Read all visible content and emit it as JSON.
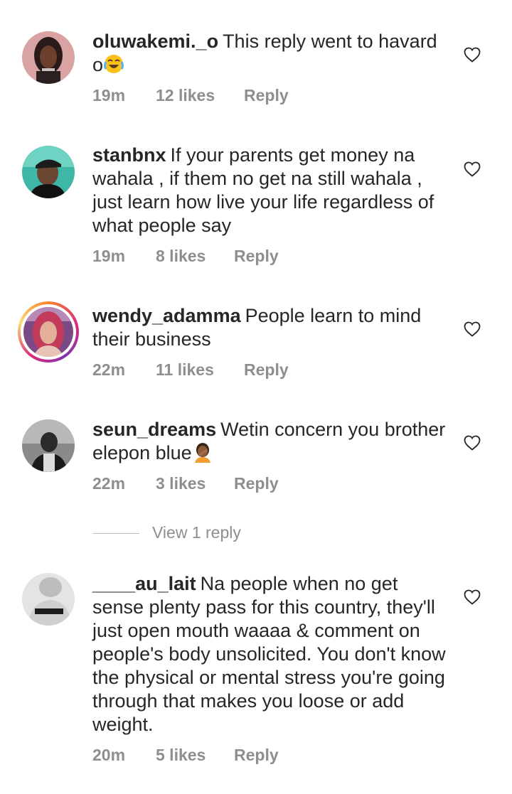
{
  "comments": [
    {
      "username": "oluwakemi._o",
      "text": "This reply went to havard o",
      "emoji_icon": "face-with-tears-of-joy-icon",
      "time": "19m",
      "likes": "12 likes",
      "reply": "Reply"
    },
    {
      "username": "stanbnx",
      "text": "If your parents get money na wahala , if them no get na still wahala , just learn how live your life regardless of what people say",
      "time": "19m",
      "likes": "8 likes",
      "reply": "Reply"
    },
    {
      "username": "wendy_adamma",
      "text": "People learn to mind their business",
      "time": "22m",
      "likes": "11 likes",
      "reply": "Reply",
      "has_story_ring": true
    },
    {
      "username": "seun_dreams",
      "text": "Wetin concern you brother elepon blue",
      "emoji_icon": "person-facepalming-icon",
      "time": "22m",
      "likes": "3 likes",
      "reply": "Reply",
      "view_replies": "View 1 reply"
    },
    {
      "username": "____au_lait",
      "text": "Na people when no get sense plenty pass for this country, they'll just open mouth waaaa & comment on people's body unsolicited. You don't know the physical or mental stress you're going through that makes you loose or add weight.",
      "time": "20m",
      "likes": "5 likes",
      "reply": "Reply"
    }
  ],
  "icons": {
    "like": "heart-outline-icon"
  },
  "colors": {
    "text": "#262626",
    "secondary": "#8e8e8e",
    "background": "#ffffff"
  }
}
